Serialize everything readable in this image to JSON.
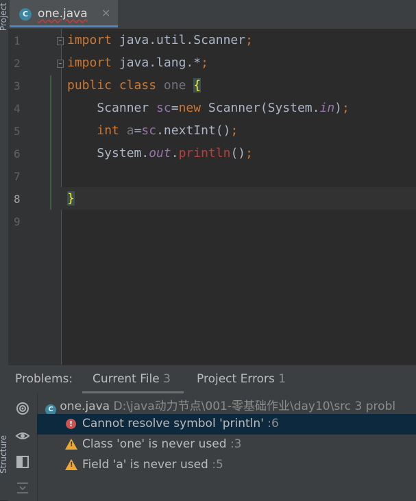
{
  "side_panel": {
    "project_label": "Project",
    "structure_label": "Structure"
  },
  "tab": {
    "icon_letter": "C",
    "label": "one.java",
    "close": "×"
  },
  "editor": {
    "line_numbers": [
      "1",
      "2",
      "3",
      "4",
      "5",
      "6",
      "7",
      "8",
      "9"
    ],
    "current_line": "8"
  },
  "problems": {
    "title": "Problems:",
    "tabs": [
      {
        "label": "Current File",
        "count": "3"
      },
      {
        "label": "Project Errors",
        "count": "1"
      }
    ],
    "file": {
      "name": "one.java",
      "path": "D:\\java动力节点\\001-零基础作业\\day10\\src",
      "summary": "3 probl"
    },
    "items": [
      {
        "severity": "error",
        "message": "Cannot resolve symbol 'println'",
        "line": ":6"
      },
      {
        "severity": "warning",
        "message": "Class 'one' is never used",
        "line": ":3"
      },
      {
        "severity": "warning",
        "message": "Field 'a' is never used",
        "line": ":5"
      }
    ]
  },
  "colors": {
    "accent": "#4a88c7",
    "error": "#c75450",
    "warning": "#f0a732",
    "keyword": "#cc7832"
  }
}
